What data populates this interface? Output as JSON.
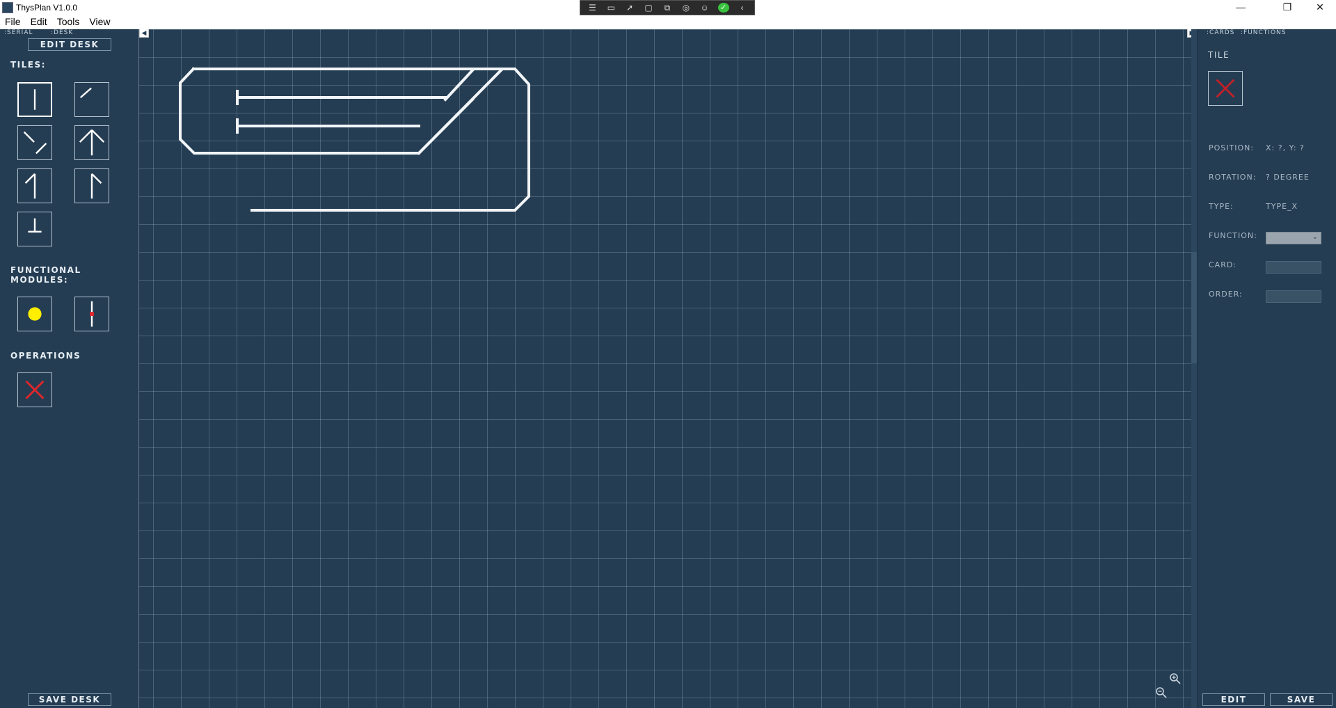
{
  "window": {
    "title": "ThysPlan V1.0.0",
    "minimize": "—",
    "restore": "❐",
    "close": "✕"
  },
  "menu": [
    "File",
    "Edit",
    "Tools",
    "View"
  ],
  "left_panel": {
    "tabs": [
      ":SERIAL",
      ":DESK"
    ],
    "edit_desk": "EDIT DESK",
    "tiles_label": "TILES:",
    "modules_label": "FUNCTIONAL MODULES:",
    "operations_label": "OPERATIONS",
    "save_desk": "SAVE DESK"
  },
  "right_panel": {
    "tabs": [
      ":CARDS",
      ":FUNCTIONS"
    ],
    "tile_label": "TILE",
    "position_label": "POSITION:",
    "position_value": "X: ?, Y: ?",
    "rotation_label": "ROTATION:",
    "rotation_value": "? DEGREE",
    "type_label": "TYPE:",
    "type_value": "TYPE_X",
    "function_label": "FUNCTION:",
    "card_label": "CARD:",
    "order_label": "ORDER:",
    "edit": "EDIT",
    "save": "SAVE"
  },
  "colors": {
    "background": "#243d53",
    "track": "#f2f5f8",
    "delete_red": "#e0262b",
    "signal_yellow": "#ffee00"
  },
  "icons": {
    "left_collapse": "chevron-left-icon",
    "right_collapse": "chevron-right-icon",
    "zoom_in": "zoom-in-icon",
    "zoom_out": "zoom-out-icon"
  }
}
